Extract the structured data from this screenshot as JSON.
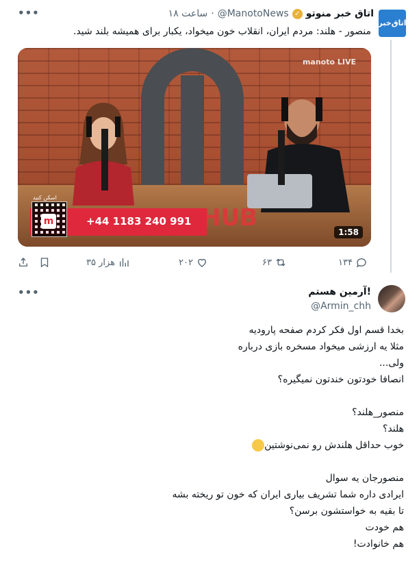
{
  "tweet1": {
    "avatar_text": "اتاق‌خبر",
    "name": "اتاق خبر منوتو",
    "handle": "@ManotoNews",
    "time": "ساعت ۱۸",
    "text": "منصور - هلند: مردم ایران، انقلاب خون میخواد، یکبار برای همیشه بلند شید.",
    "media": {
      "channel_badge": "manoto LIVE",
      "scan_label": "اسکن کنید",
      "phone_number": "+44 1183 240 991",
      "studio_sign": "HUB",
      "duration": "1:58"
    },
    "actions": {
      "replies": "۱۳۴",
      "retweets": "۶۳",
      "likes": "۲۰۲",
      "views": "۳۵ هزار"
    }
  },
  "tweet2": {
    "name": "!آرمین هستم",
    "handle": "@Armin_chh",
    "lines": [
      "بخدا قسم اول فکر کردم صفحه پارودیه",
      "مثلا یه ارزشی میخواد مسخره بازی درباره",
      "ولی...",
      "انصافا خودتون خندتون نمیگیره؟",
      "",
      "منصور_هلند؟",
      "هلند؟",
      "خوب حداقل هلندش رو نمی‌نوشتین",
      "",
      "منصورجان یه سوال",
      "ایرادی داره شما تشریف بیاری ایران که خون تو ریخته بشه",
      "تا بقیه به خواستشون برسن؟",
      "هم خودت",
      "هم خانوادت!"
    ]
  },
  "icons": {
    "more": "more-horizontal-icon",
    "verified": "verified-badge-icon",
    "reply": "reply-icon",
    "retweet": "retweet-icon",
    "like": "heart-icon",
    "views": "views-icon",
    "bookmark": "bookmark-icon",
    "share": "share-icon"
  },
  "colors": {
    "verified": "#e8b13a",
    "text": "#0f1419",
    "muted": "#536471"
  }
}
